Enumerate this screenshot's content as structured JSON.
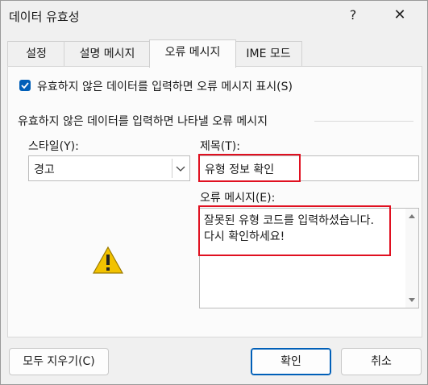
{
  "window": {
    "title": "데이터 유효성",
    "help": "?",
    "close": "✕"
  },
  "tabs": [
    {
      "label": "설정"
    },
    {
      "label": "설명 메시지"
    },
    {
      "label": "오류 메시지"
    },
    {
      "label": "IME 모드"
    }
  ],
  "panel": {
    "show_error_checkbox": {
      "label": "유효하지 않은 데이터를 입력하면 오류 메시지 표시(S)",
      "checked": true
    },
    "group_label": "유효하지 않은 데이터를 입력하면 나타낼 오류 메시지",
    "style": {
      "label": "스타일(Y):",
      "value": "경고"
    },
    "title": {
      "label": "제목(T):",
      "value": "유형 정보 확인"
    },
    "error_message": {
      "label": "오류 메시지(E):",
      "value": "잘못된 유형 코드를 입력하셨습니다. 다시 확인하세요!"
    },
    "icon": "warning-triangle-icon"
  },
  "buttons": {
    "clear_all": "모두 지우기(C)",
    "ok": "확인",
    "cancel": "취소"
  },
  "colors": {
    "accent": "#005fb8",
    "highlight_box": "#e01020",
    "warning_icon": "#f2c200"
  }
}
